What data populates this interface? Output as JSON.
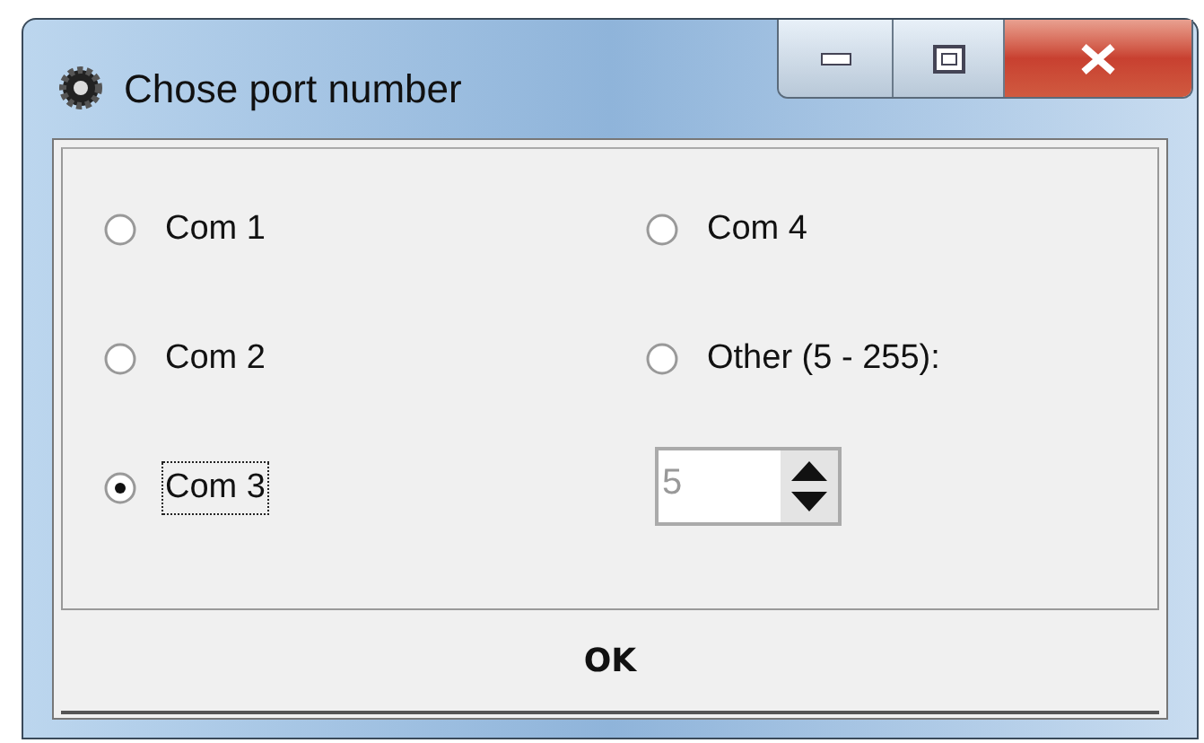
{
  "window": {
    "title": "Chose port number"
  },
  "options": [
    {
      "label": "Com 1",
      "selected": false,
      "focused": false
    },
    {
      "label": "Com 4",
      "selected": false,
      "focused": false
    },
    {
      "label": "Com 2",
      "selected": false,
      "focused": false
    },
    {
      "label": "Other (5 - 255):",
      "selected": false,
      "focused": false
    },
    {
      "label": "Com 3",
      "selected": true,
      "focused": true
    }
  ],
  "port_spinner": {
    "value": "5",
    "disabled": true
  },
  "buttons": [
    "OK"
  ]
}
